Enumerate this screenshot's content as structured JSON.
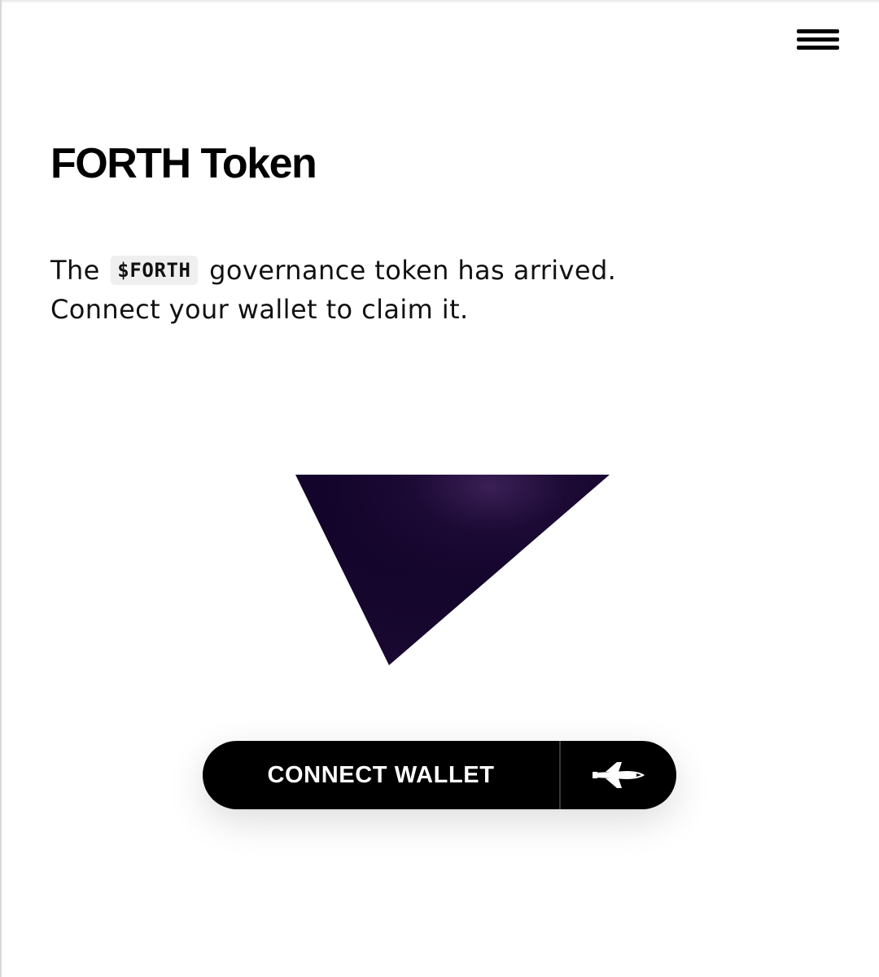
{
  "header": {
    "menu_icon": "hamburger-menu-icon"
  },
  "main": {
    "title": "FORTH Token",
    "intro_prefix": "The",
    "token_symbol": "$FORTH",
    "intro_suffix": "governance token has arrived.",
    "intro_line2": "Connect your wallet to claim it."
  },
  "cta": {
    "label": "CONNECT WALLET",
    "icon": "space-shuttle-icon"
  },
  "colors": {
    "token_shape": "#14042b",
    "button_bg": "#000000",
    "button_text": "#ffffff"
  }
}
